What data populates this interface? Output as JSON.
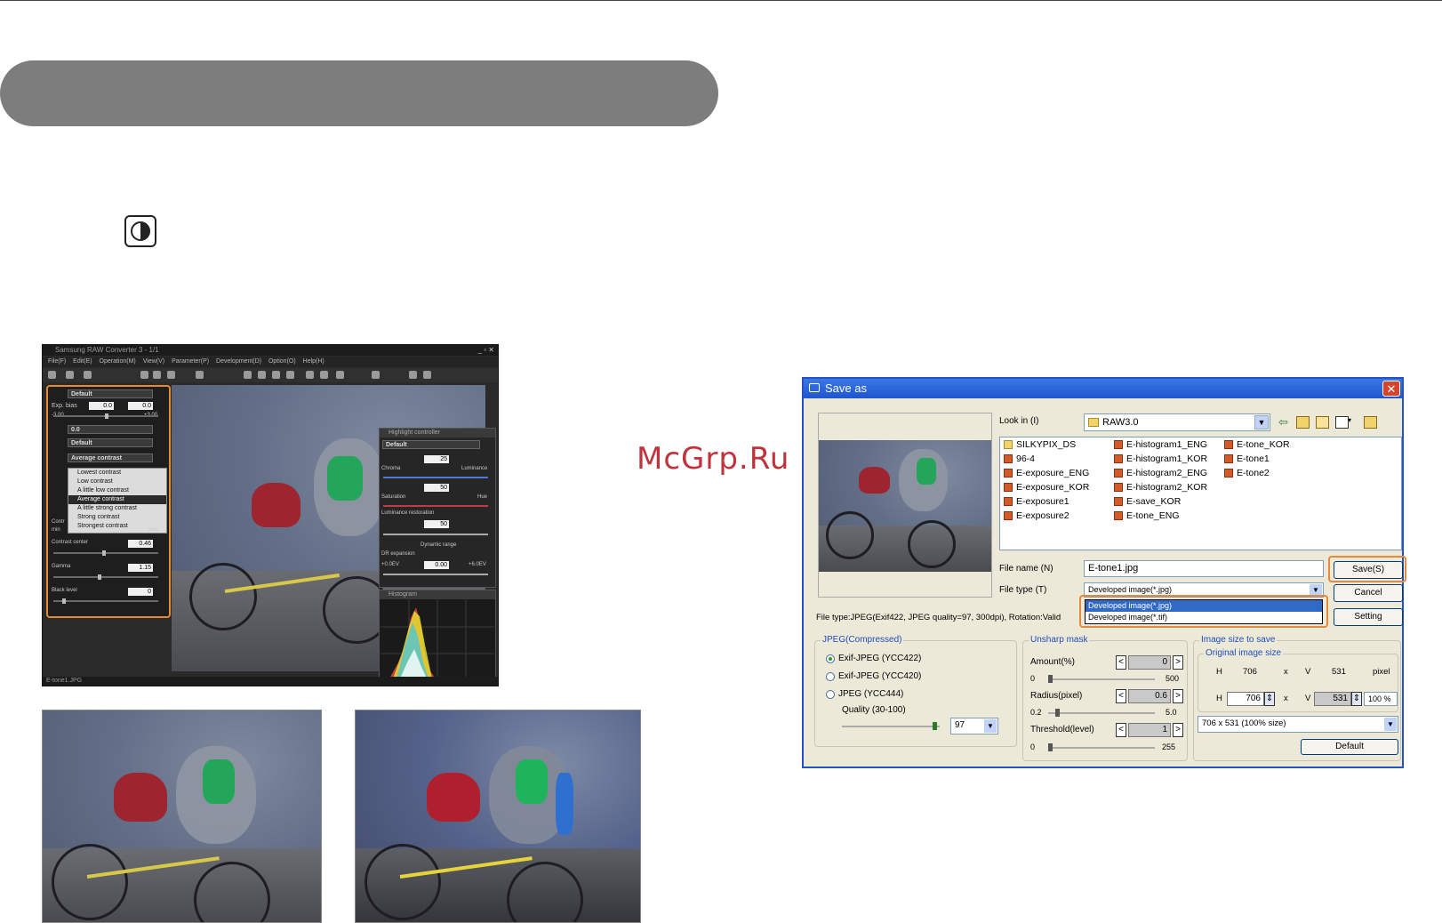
{
  "software_window": {
    "title": "Samsung RAW Converter 3 - 1/1",
    "menus": [
      "File(F)",
      "Edit(E)",
      "Operation(M)",
      "View(V)",
      "Parameter(P)",
      "Development(D)",
      "Option(O)",
      "Help(H)"
    ],
    "left_panel": {
      "preset": "Default",
      "exp_bias_label": "Exp. bias",
      "exp_bias_value": "0.0",
      "exp_bias_value2": "0.0",
      "exp_min": "-3.00",
      "exp_max": "+3.00",
      "wb_value": "0.0",
      "tone_preset": "Default",
      "contrast_selected": "Average contrast",
      "contrast_options": [
        "Lowest contrast",
        "Low contrast",
        "A little low contrast",
        "Average contrast",
        "A little strong contrast",
        "Strong contrast",
        "Strongest contrast"
      ],
      "contrast_label": "Contr",
      "contrast_center_label": "Contrast center",
      "contrast_center_value": "0.46",
      "gamma_label": "Gamma",
      "gamma_value": "1.15",
      "black_level_label": "Black level",
      "black_level_value": "0",
      "min": "min",
      "max": "max"
    },
    "highlight_panel": {
      "title": "Highlight controller",
      "preset": "Default",
      "chroma": "Chroma",
      "chroma_value": "25",
      "luminance": "Luminance",
      "saturation": "Saturation",
      "saturation_value": "50",
      "hue": "Hue",
      "lum_restoration": "Luminance restoration",
      "lum_value": "50",
      "dynamic_range": "Dynamic range",
      "dr_expansion": "DR expansion",
      "dr_min": "+0.0EV",
      "dr_value": "0.00",
      "dr_max": "+6.0EV"
    },
    "histogram_title": "Histogram",
    "status": "E-tone1.JPG"
  },
  "watermark": "McGrp.Ru",
  "save_dialog": {
    "title": "Save as",
    "look_in_label": "Look in (I)",
    "look_in_value": "RAW3.0",
    "files_col1": [
      "SILKYPIX_DS",
      "96-4",
      "E-exposure_ENG",
      "E-exposure_KOR",
      "E-exposure1",
      "E-exposure2"
    ],
    "files_col2": [
      "E-histogram1_ENG",
      "E-histogram1_KOR",
      "E-histogram2_ENG",
      "E-histogram2_KOR",
      "E-save_KOR",
      "E-tone_ENG"
    ],
    "files_col3": [
      "E-tone_KOR",
      "E-tone1",
      "E-tone2"
    ],
    "file_name_label": "File name (N)",
    "file_name_value": "E-tone1.jpg",
    "file_type_label": "File type (T)",
    "file_type_value": "Developed image(*.jpg)",
    "file_type_options": [
      "Developed image(*.jpg)",
      "Developed image(*.tif)"
    ],
    "save_button": "Save(S)",
    "cancel_button": "Cancel",
    "setting_button": "Setting",
    "file_info": "File type:JPEG(Exif422, JPEG quality=97, 300dpi), Rotation:Valid",
    "jpeg_group": "JPEG(Compressed)",
    "radio_options": [
      "Exif-JPEG  (YCC422)",
      "Exif-JPEG  (YCC420)",
      "JPEG  (YCC444)"
    ],
    "quality_label": "Quality (30-100)",
    "quality_value": "97",
    "unsharp_group": "Unsharp mask",
    "amount_label": "Amount(%)",
    "amount_value": "0",
    "amount_min": "0",
    "amount_max": "500",
    "radius_label": "Radius(pixel)",
    "radius_value": "0.6",
    "radius_min": "0.2",
    "radius_max": "5.0",
    "threshold_label": "Threshold(level)",
    "threshold_value": "1",
    "threshold_min": "0",
    "threshold_max": "255",
    "size_group": "Image size to save",
    "original_size_label": "Original image size",
    "orig_h_label": "H",
    "orig_h": "706",
    "x_label": "x",
    "orig_v_label": "V",
    "orig_v": "531",
    "pixel_label": "pixel",
    "new_h": "706",
    "new_v": "531",
    "percent": "100 %",
    "size_select": "706 x  531  (100% size)",
    "default_button": "Default"
  },
  "colors": {
    "highlight_outline": "#e8893a",
    "dialog_title_bar": "#1f55cf",
    "watermark": "#c0333d"
  }
}
